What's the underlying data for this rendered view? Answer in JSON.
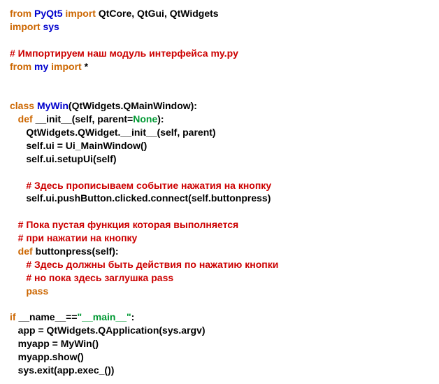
{
  "lines": {
    "l1_from": "from",
    "l1_pyqt5": "PyQt5",
    "l1_import": "import",
    "l1_rest": "QtCore, QtGui, QtWidgets",
    "l2_import": "import",
    "l2_sys": "sys",
    "l3_cmt": "# Импортируем наш модуль интерфейса my.py",
    "l4_from": "from",
    "l4_my": "my",
    "l4_import": "import",
    "l4_star": "*",
    "l5_class": "class",
    "l5_name": "MyWin",
    "l5_rest": "(QtWidgets.QMainWindow):",
    "l6_def": "def",
    "l6_name": "__init__",
    "l6_open": "(self, parent=",
    "l6_none": "None",
    "l6_close": "):",
    "l7": "QtWidgets.QWidget.__init__(self, parent)",
    "l8": "self.ui = Ui_MainWindow()",
    "l9": "self.ui.setupUi(self)",
    "l10_cmt": "# Здесь прописываем событие нажатия на кнопку",
    "l11": "self.ui.pushButton.clicked.connect(self.buttonpress)",
    "l12_cmt": "# Пока пустая функция которая выполняется",
    "l13_cmt": "# при нажатии на кнопку",
    "l14_def": "def",
    "l14_name": "buttonpress",
    "l14_rest": "(self):",
    "l15_cmt": "# Здесь должны быть действия по нажатию кнопки",
    "l16_cmt": "# но пока здесь заглушка pass",
    "l17_pass": "pass",
    "l18_if": "if",
    "l18_name": "__name__==",
    "l18_str": "\"__main__\"",
    "l18_colon": ":",
    "l19": "app = QtWidgets.QApplication(sys.argv)",
    "l20": "myapp = MyWin()",
    "l21": "myapp.show()",
    "l22": "sys.exit(app.exec_())"
  }
}
